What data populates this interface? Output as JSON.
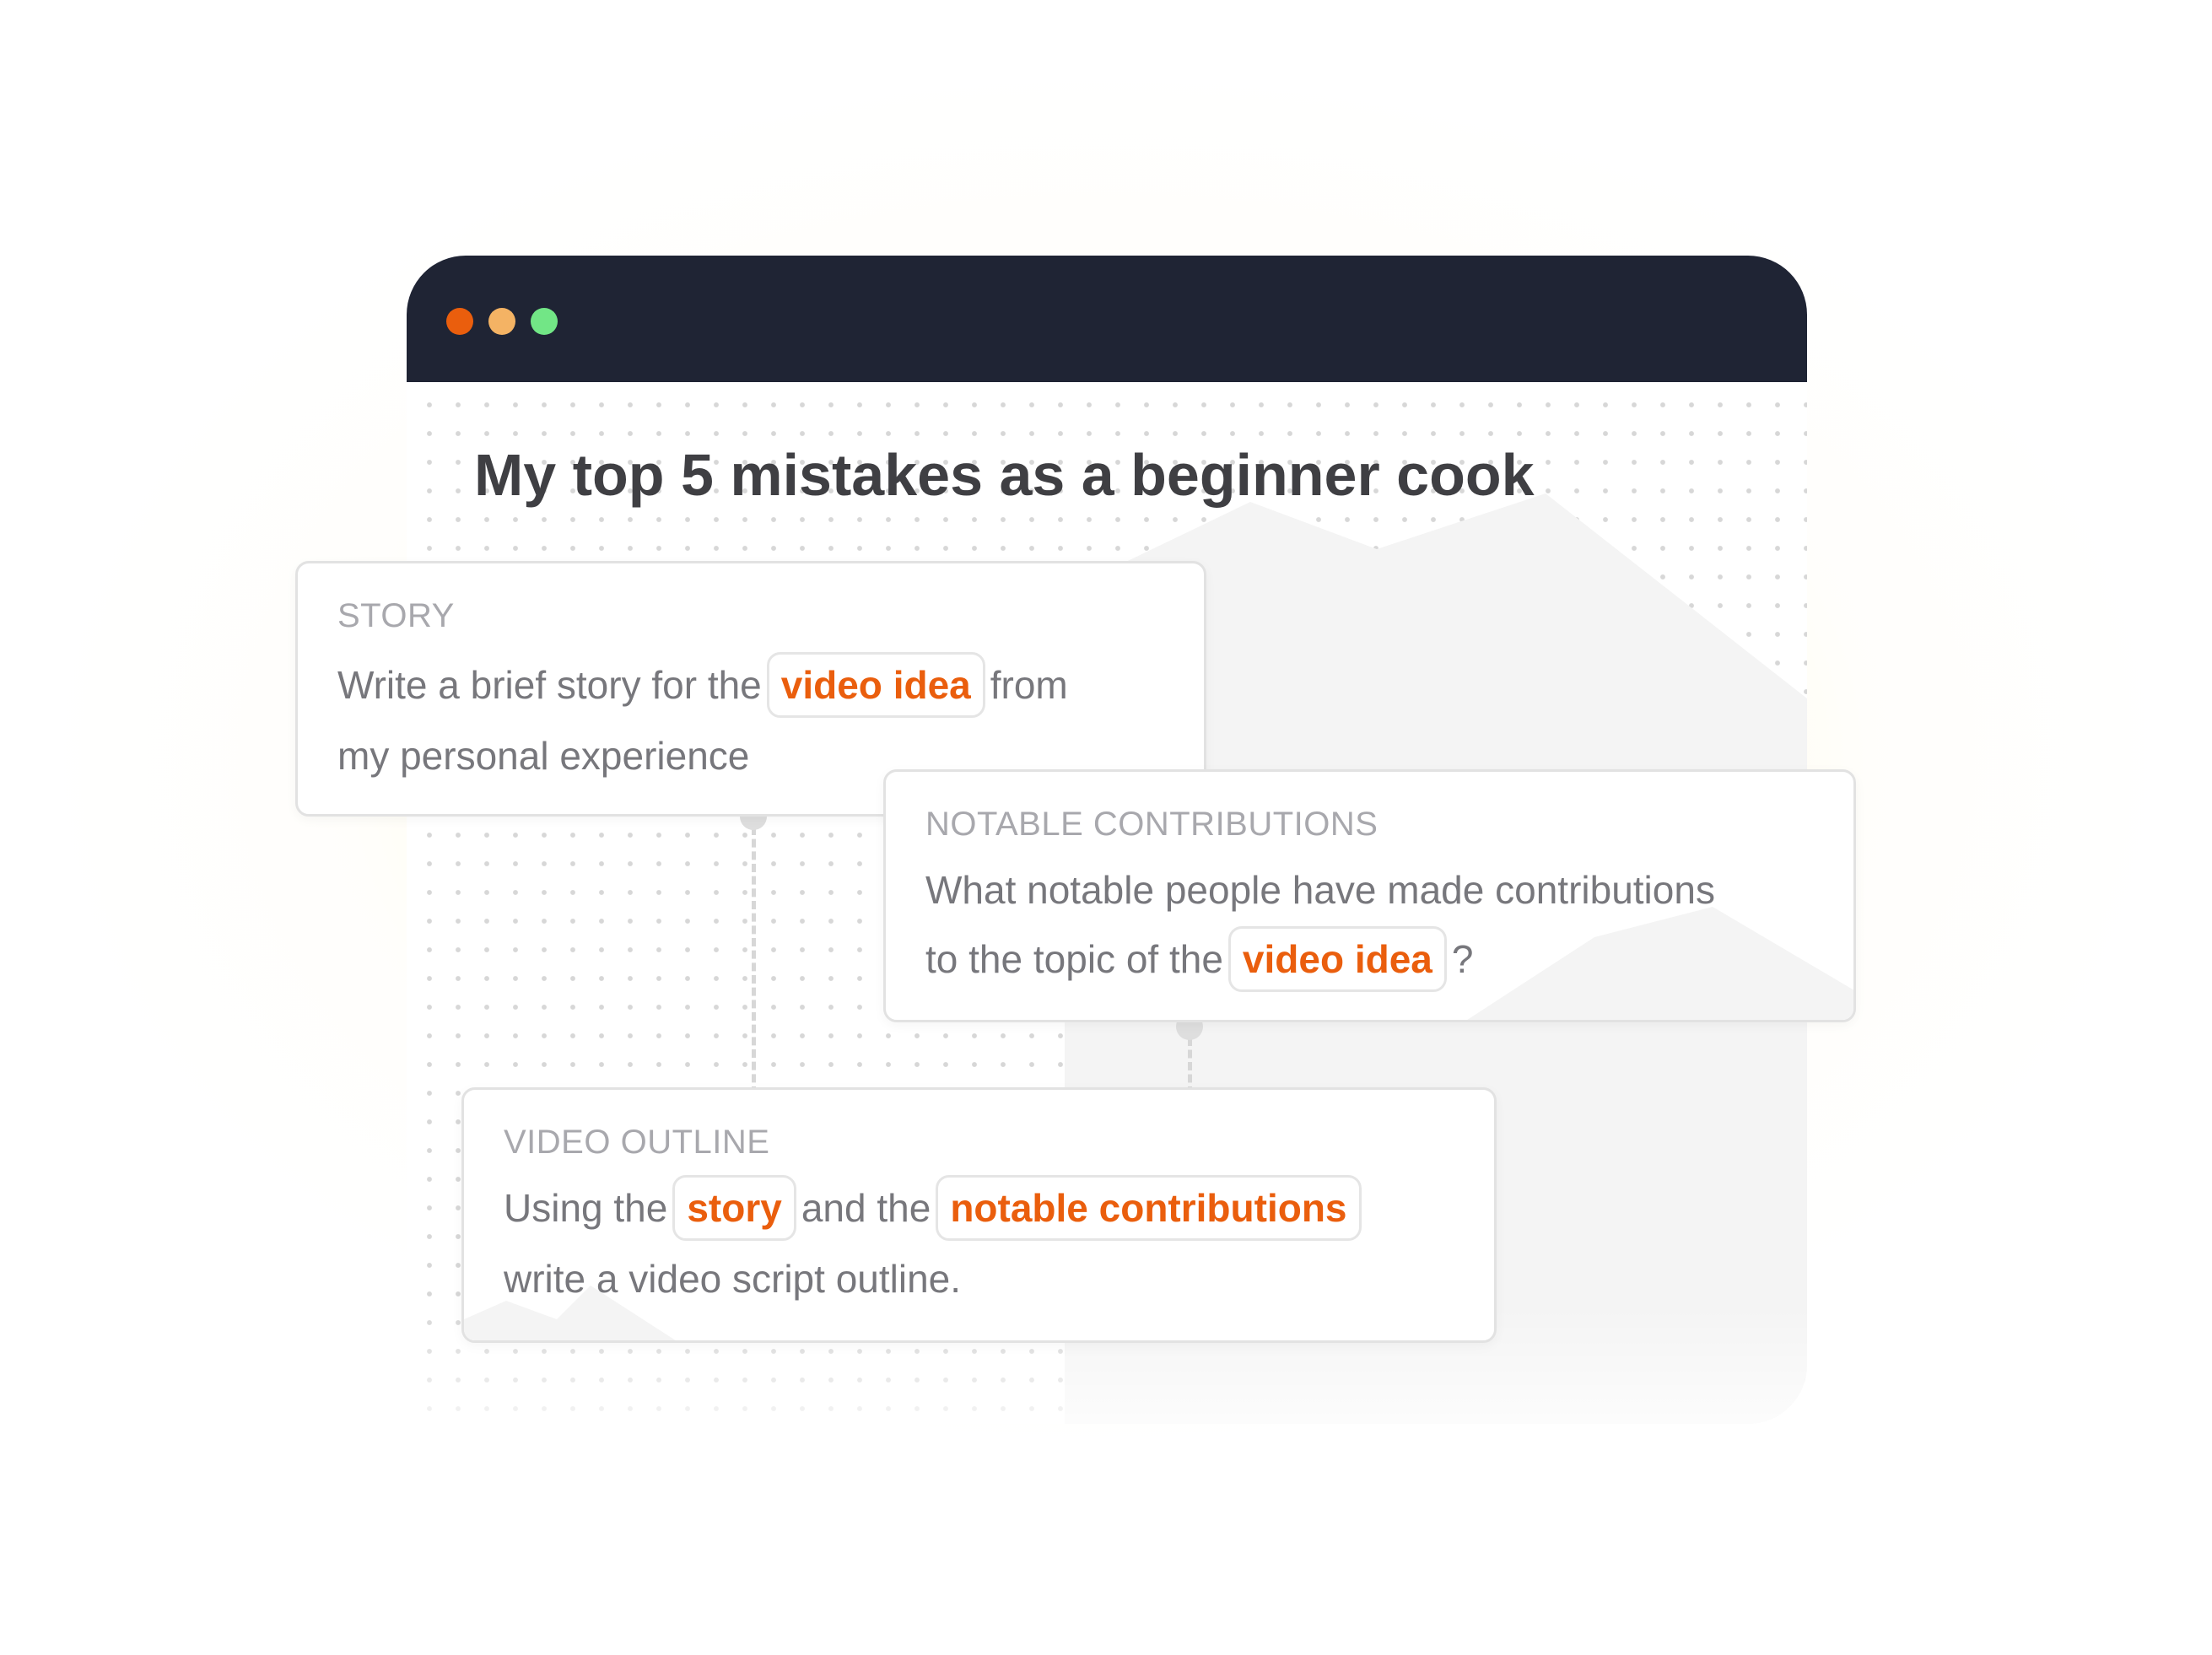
{
  "window": {
    "title": "My top 5 mistakes as a beginner cook",
    "controls": {
      "close_color": "#ea5e0d",
      "minimize_color": "#f4b364",
      "maximize_color": "#72e686"
    }
  },
  "cards": {
    "story": {
      "label": "STORY",
      "line1_before": "Write a brief story for the",
      "line1_chip": "video idea",
      "line1_after": "from",
      "line2": "my personal experience"
    },
    "notable": {
      "label": "NOTABLE CONTRIBUTIONS",
      "line1": "What notable people have made contributions",
      "line2_before": "to the topic of the",
      "line2_chip": "video idea",
      "line2_after": "?"
    },
    "outline": {
      "label": "VIDEO OUTLINE",
      "line1_before": "Using the",
      "line1_chip1": "story",
      "line1_middle": "and the",
      "line1_chip2": "notable contributions",
      "line2": "write a video script outline."
    }
  },
  "colors": {
    "titlebar": "#1f2434",
    "chip_text": "#ea5e0d",
    "body_text": "#77777c",
    "label_text": "#a8a8ad"
  }
}
